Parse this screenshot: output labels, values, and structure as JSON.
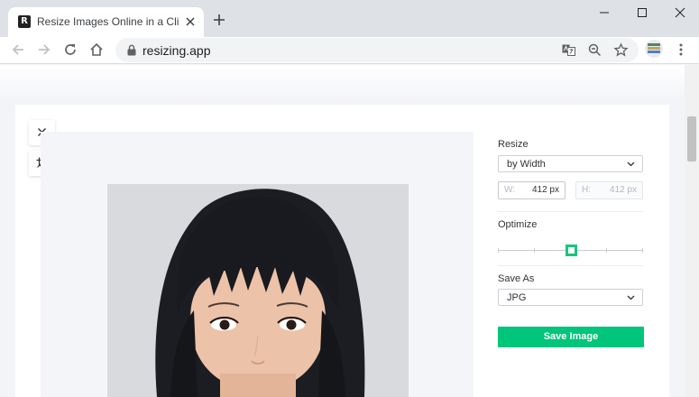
{
  "browser": {
    "tab_title": "Resize Images Online in a Click",
    "favicon_letter": "R",
    "url": "resizing.app"
  },
  "panel": {
    "resize_label": "Resize",
    "resize_mode": "by Width",
    "width_prefix": "W:",
    "width_value": "412 px",
    "height_prefix": "H:",
    "height_value": "412 px",
    "optimize_label": "Optimize",
    "optimize_level": 0.5,
    "save_as_label": "Save As",
    "format": "JPG",
    "save_button": "Save Image"
  },
  "colors": {
    "accent": "#00c57a",
    "slider_thumb": "#17c77b"
  },
  "icons": [
    "close-icon",
    "crop-icon",
    "lock-icon",
    "translate-icon",
    "zoom-icon",
    "star-icon",
    "menu-icon"
  ]
}
